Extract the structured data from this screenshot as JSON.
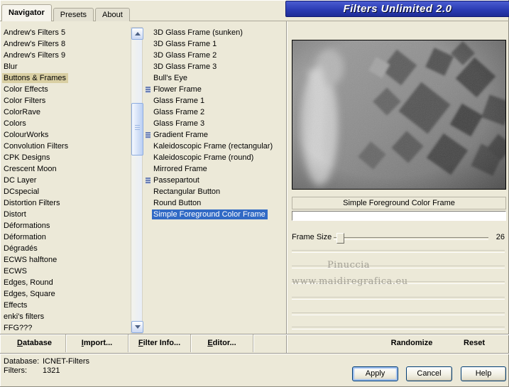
{
  "banner": {
    "title": "Filters Unlimited 2.0"
  },
  "tabs": [
    {
      "label": "Navigator",
      "active": true
    },
    {
      "label": "Presets",
      "active": false
    },
    {
      "label": "About",
      "active": false
    }
  ],
  "categories": {
    "selected": "Buttons & Frames",
    "items": [
      "Andrew's Filters 5",
      "Andrew's Filters 8",
      "Andrew's Filters 9",
      "Blur",
      "Buttons & Frames",
      "Color Effects",
      "Color Filters",
      "ColorRave",
      "Colors",
      "ColourWorks",
      "Convolution Filters",
      "CPK Designs",
      "Crescent Moon",
      "DC Layer",
      "DCspecial",
      "Distortion Filters",
      "Distort",
      "Déformations",
      "Déformation",
      "Dégradés",
      "ECWS halftone",
      "ECWS",
      "Edges, Round",
      "Edges, Square",
      "Effects",
      "enki's filters",
      "FFG???"
    ]
  },
  "filters": {
    "selected": "Simple Foreground Color Frame",
    "items": [
      {
        "label": "3D Glass Frame (sunken)",
        "marker": false
      },
      {
        "label": "3D Glass Frame 1",
        "marker": false
      },
      {
        "label": "3D Glass Frame 2",
        "marker": false
      },
      {
        "label": "3D Glass Frame 3",
        "marker": false
      },
      {
        "label": "Bull's Eye",
        "marker": false
      },
      {
        "label": "Flower Frame",
        "marker": true
      },
      {
        "label": "Glass Frame 1",
        "marker": false
      },
      {
        "label": "Glass Frame 2",
        "marker": false
      },
      {
        "label": "Glass Frame 3",
        "marker": false
      },
      {
        "label": "Gradient Frame",
        "marker": true
      },
      {
        "label": "Kaleidoscopic Frame (rectangular)",
        "marker": false
      },
      {
        "label": "Kaleidoscopic Frame (round)",
        "marker": false
      },
      {
        "label": "Mirrored Frame",
        "marker": false
      },
      {
        "label": "Passepartout",
        "marker": true
      },
      {
        "label": "Rectangular Button",
        "marker": false
      },
      {
        "label": "Round Button",
        "marker": false
      },
      {
        "label": "Simple Foreground Color Frame",
        "marker": false
      }
    ]
  },
  "preview": {
    "caption": "Simple Foreground Color Frame"
  },
  "sliders": {
    "frame_size": {
      "label": "Frame Size",
      "value": "26"
    }
  },
  "watermark": {
    "line1": "Pinuccia",
    "line2": "www.maidiregrafica.eu"
  },
  "toolbar": {
    "left_buttons": [
      {
        "name": "database-button",
        "label": "Database",
        "underline_first": true
      },
      {
        "name": "import-button",
        "label": "Import...",
        "underline_first": true
      },
      {
        "name": "filter-info-button",
        "label": "Filter Info...",
        "underline_first": true
      },
      {
        "name": "editor-button",
        "label": "Editor...",
        "underline_first": true
      }
    ],
    "right_buttons": [
      {
        "name": "randomize-button",
        "label": "Randomize"
      },
      {
        "name": "reset-button",
        "label": "Reset"
      }
    ]
  },
  "status": {
    "database_label": "Database:",
    "database_value": "ICNET-Filters",
    "filters_label": "Filters:",
    "filters_value": "1321"
  },
  "action_buttons": {
    "apply": "Apply",
    "cancel": "Cancel",
    "help": "Help"
  },
  "colors": {
    "dialog_background": "#ECE9D8",
    "selection_blue": "#316AC5",
    "selection_tan": "#D9CFA3",
    "banner_blue": "#2B3CB4",
    "xp_button_border": "#003C74"
  }
}
